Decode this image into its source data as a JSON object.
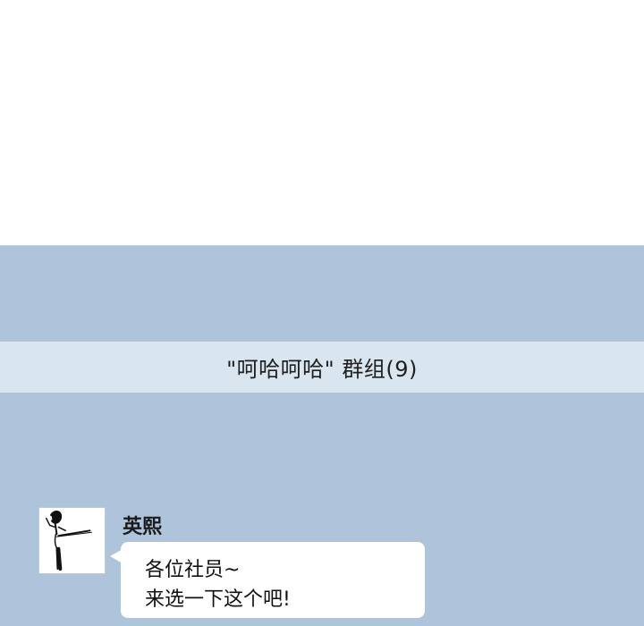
{
  "group": {
    "title": "\"呵哈呵哈\" 群组(9)"
  },
  "message": {
    "sender": "英熙",
    "avatar_icon": "kicking-figure-avatar",
    "lines": [
      "各位社员~",
      "来选一下这个吧!"
    ]
  },
  "colors": {
    "chat_background": "#aec4da",
    "banner_background": "#d9e5ef",
    "bubble_background": "#ffffff",
    "top_background": "#ffffff"
  }
}
